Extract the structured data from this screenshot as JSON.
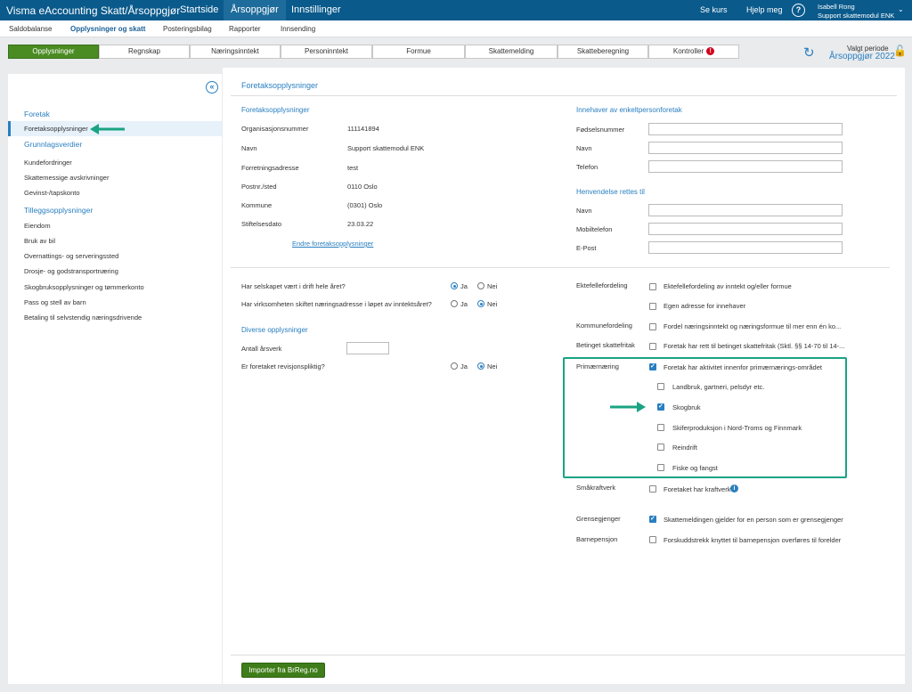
{
  "app": {
    "title": "Visma eAccounting Skatt/Årsoppgjør",
    "nav": [
      "Startside",
      "Årsoppgjør",
      "Innstillinger"
    ],
    "se_kurs": "Se kurs",
    "help": "Hjelp meg",
    "help_icon": "?",
    "user": {
      "name": "Isabell Rong",
      "company": "Support skattemodul ENK"
    }
  },
  "subnav": [
    "Saldobalanse",
    "Opplysninger og skatt",
    "Posteringsbilag",
    "Rapporter",
    "Innsending"
  ],
  "tabs": [
    "Opplysninger",
    "Regnskap",
    "Næringsinntekt",
    "Personinntekt",
    "Formue",
    "Skattemelding",
    "Skatteberegning",
    "Kontroller"
  ],
  "tab_error_icon": "!",
  "period": {
    "label": "Valgt periode",
    "value": "Årsoppgjør 2022"
  },
  "sidebar": {
    "collapse_icon": "«",
    "foretak_head": "Foretak",
    "foretak_items": [
      "Foretaksopplysninger"
    ],
    "grunn_head": "Grunnlagsverdier",
    "grunn_items": [
      "Kundefordringer",
      "Skattemessige avskrivninger",
      "Gevinst-/tapskonto"
    ],
    "tillegg_head": "Tilleggsopplysninger",
    "tillegg_items": [
      "Eiendom",
      "Bruk av bil",
      "Overnattings- og serveringssted",
      "Drosje- og godstransportnæring",
      "Skogbruksopplysninger og tømmerkonto",
      "Pass og stell av barn",
      "Betaling til selvstendig næringsdrivende"
    ]
  },
  "main": {
    "title": "Foretaksopplysninger",
    "left_head": "Foretaksopplysninger",
    "fields": [
      {
        "label": "Organisasjonsnummer",
        "value": "111141894"
      },
      {
        "label": "Navn",
        "value": "Support skattemodul ENK"
      },
      {
        "label": "Forretningsadresse",
        "value": "test"
      },
      {
        "label": "Postnr./sted",
        "value": "0110 Oslo"
      },
      {
        "label": "Kommune",
        "value": "(0301) Oslo"
      },
      {
        "label": "Stiftelsesdato",
        "value": "23.03.22"
      }
    ],
    "edit_link": "Endre foretaksopplysninger",
    "innehaver_head": "Innehaver av enkeltpersonforetak",
    "innehaver_fields": [
      "Fødselsnummer",
      "Navn",
      "Telefon"
    ],
    "henv_head": "Henvendelse rettes til",
    "henv_fields": [
      "Navn",
      "Mobiltelefon",
      "E-Post"
    ],
    "q1": "Har selskapet vært i drift hele året?",
    "q2": "Har virksomheten skiftet næringsadresse i løpet av inntektsåret?",
    "q3": "Er foretaket revisjonspliktig?",
    "ja": "Ja",
    "nei": "Nei",
    "diverse_head": "Diverse opplysninger",
    "antall_label": "Antall årsverk",
    "ekt_label": "Ektefellefordeling",
    "ekt_opts": [
      "Ektefellefordeling av inntekt og/eller formue",
      "Egen adresse for innehaver"
    ],
    "kom_label": "Kommunefordeling",
    "kom_opt": "Fordel næringsinntekt og næringsformue til mer enn én ko...",
    "bet_label": "Betinget skattefritak",
    "bet_opt": "Foretak har rett til betinget skattefritak (Sktl. §§ 14-70 til 14-...",
    "prim_label": "Primærnæring",
    "prim_opt": "Foretak har aktivitet innenfor primærnærings-området",
    "prim_sub": [
      "Landbruk, gartneri, pelsdyr etc.",
      "Skogbruk",
      "Skiferproduksjon i Nord-Troms og Finnmark",
      "Reindrift",
      "Fiske og fangst"
    ],
    "sma_label": "Småkraftverk",
    "sma_opt": "Foretaket har kraftverk",
    "info_icon": "i",
    "gren_label": "Grensegjenger",
    "gren_opt": "Skattemeldingen gjelder for en person som er grensegjenger",
    "barn_label": "Barnepensjon",
    "barn_opt": "Forskuddstrekk knyttet til barnepensjon overføres til forelder"
  },
  "import_button": "Importer fra BrReg.no",
  "colors": {
    "topbar": "#0a5a8c",
    "active_tab": "#4a8b22",
    "accent": "#2a7fc0",
    "highlight": "#1aa384"
  }
}
